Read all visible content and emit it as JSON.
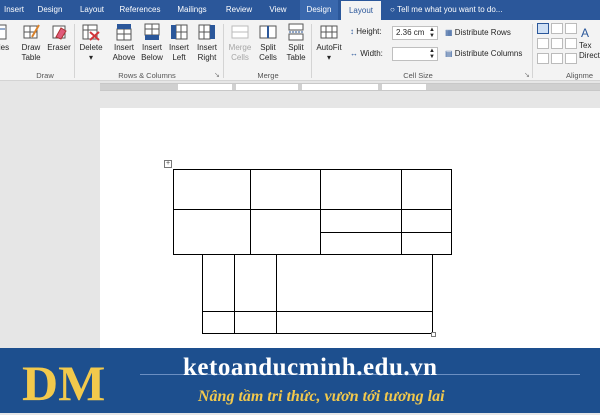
{
  "tabs": [
    {
      "label": "Insert"
    },
    {
      "label": "Design"
    },
    {
      "label": "Layout"
    },
    {
      "label": "References"
    },
    {
      "label": "Mailings"
    },
    {
      "label": "Review"
    },
    {
      "label": "View"
    },
    {
      "label": "Design"
    },
    {
      "label": "Layout"
    }
  ],
  "tell_me": "Tell me what you want to do...",
  "ribbon": {
    "draw": {
      "label": "Draw",
      "draw_table": [
        "Draw",
        "Table"
      ],
      "eraser": "Eraser",
      "properties": "ies"
    },
    "rows_columns": {
      "label": "Rows & Columns",
      "delete": "Delete",
      "insert_above": [
        "Insert",
        "Above"
      ],
      "insert_below": [
        "Insert",
        "Below"
      ],
      "insert_left": [
        "Insert",
        "Left"
      ],
      "insert_right": [
        "Insert",
        "Right"
      ]
    },
    "merge": {
      "label": "Merge",
      "merge_cells": [
        "Merge",
        "Cells"
      ],
      "split_cells": [
        "Split",
        "Cells"
      ],
      "split_table": [
        "Split",
        "Table"
      ]
    },
    "cell_size": {
      "label": "Cell Size",
      "autofit": "AutoFit",
      "height_label": "Height:",
      "height_value": "2.36 cm",
      "width_label": "Width:",
      "width_value": "",
      "distribute_rows": "Distribute Rows",
      "distribute_columns": "Distribute Columns"
    },
    "alignment": {
      "label": "Alignme",
      "text_direction": [
        "Tex",
        "Direct"
      ]
    }
  },
  "banner": {
    "site": "ketoanducminh.edu.vn",
    "slogan": "Nâng tầm tri thức, vươn tới tương lai",
    "logo": "DM"
  },
  "colors": {
    "word_blue": "#2b579a",
    "banner_blue": "#1d4f8e",
    "slogan_gold": "#f2c94c"
  }
}
